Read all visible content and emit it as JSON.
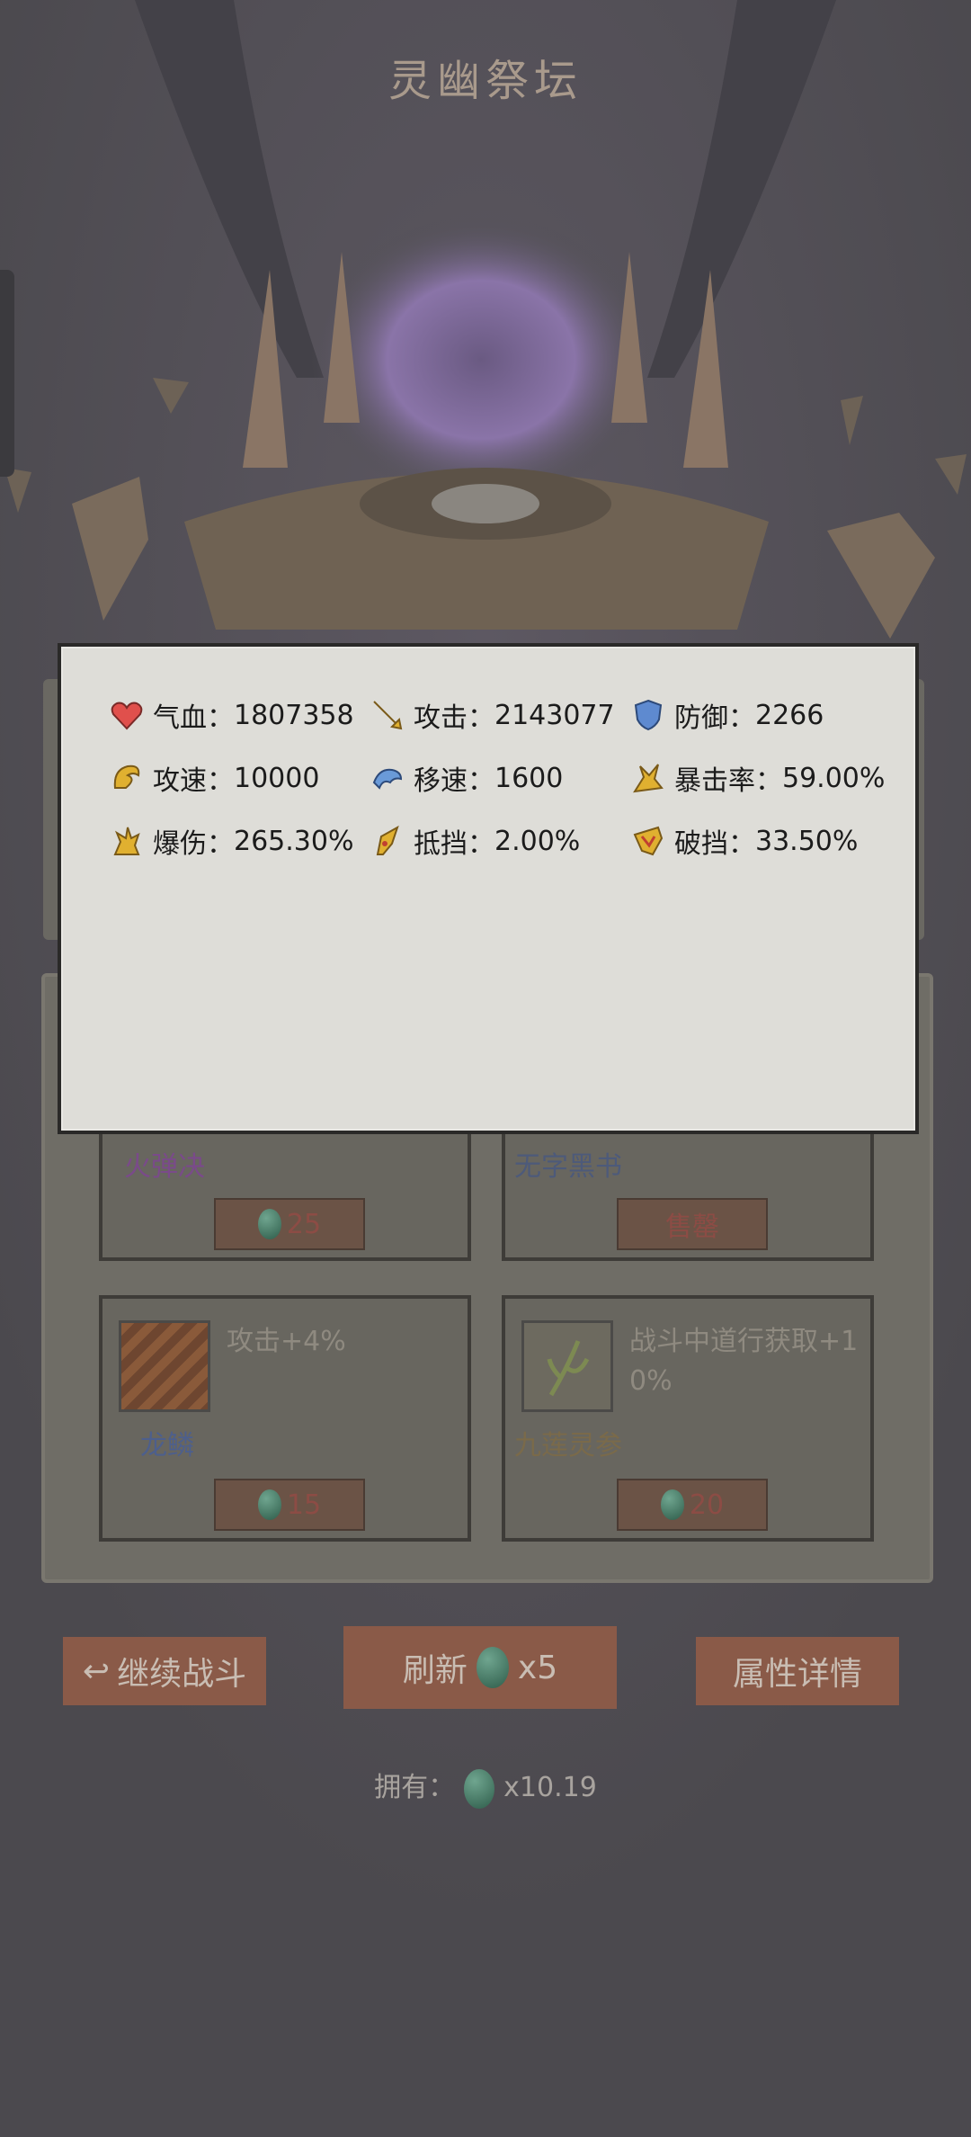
{
  "header": {
    "title": "灵幽祭坛"
  },
  "stats": [
    {
      "icon": "heart-icon",
      "label": "气血：",
      "value": "1807358"
    },
    {
      "icon": "sword-icon",
      "label": "攻击：",
      "value": "2143077"
    },
    {
      "icon": "shield-icon",
      "label": "防御：",
      "value": "2266"
    },
    {
      "icon": "attack-speed-icon",
      "label": "攻速：",
      "value": "10000"
    },
    {
      "icon": "move-speed-icon",
      "label": "移速：",
      "value": "1600"
    },
    {
      "icon": "crit-rate-icon",
      "label": "暴击率：",
      "value": "59.00%"
    },
    {
      "icon": "crit-damage-icon",
      "label": "爆伤：",
      "value": "265.30%"
    },
    {
      "icon": "block-icon",
      "label": "抵挡：",
      "value": "2.00%"
    },
    {
      "icon": "break-block-icon",
      "label": "破挡：",
      "value": "33.50%"
    }
  ],
  "shop": {
    "items": [
      {
        "name": "火弹决",
        "price": "25",
        "name_color": "#7a4a8a"
      },
      {
        "name": "无字黑书",
        "price": "售罄",
        "name_color": "#4d5a7a"
      },
      {
        "name": "龙鳞",
        "desc": "攻击+4%",
        "price": "15",
        "name_color": "#4d5f8c"
      },
      {
        "name": "九莲灵参",
        "desc": "战斗中道行获取+1\n0%",
        "price": "20",
        "name_color": "#7a6a4a"
      }
    ]
  },
  "buttons": {
    "continue": "继续战斗",
    "refresh": "刷新",
    "refresh_cost": "x5",
    "details": "属性详情"
  },
  "owned": {
    "label": "拥有：",
    "value": "x10.19"
  }
}
